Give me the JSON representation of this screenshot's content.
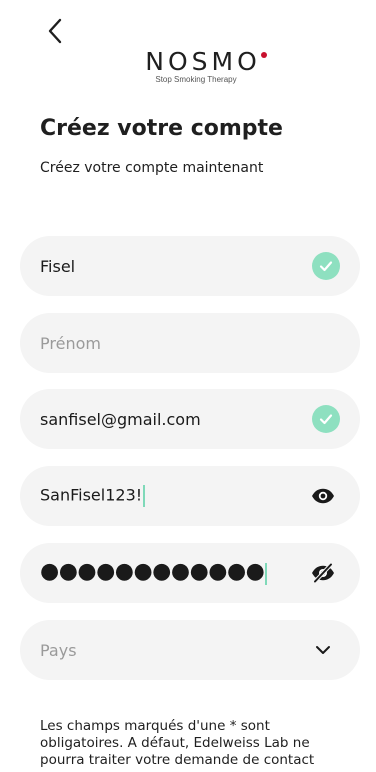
{
  "logo": {
    "wordmark": "NOSMO",
    "tagline": "Stop Smoking Therapy",
    "accent_color": "#c8102e"
  },
  "header": {
    "back_icon": "chevron-left-icon"
  },
  "title": "Créez votre compte",
  "subtitle": "Créez votre compte maintenant",
  "form": {
    "last_name": {
      "value": "Fisel",
      "valid": true
    },
    "first_name": {
      "placeholder": "Prénom",
      "value": ""
    },
    "email": {
      "value": "sanfisel@gmail.com",
      "valid": true
    },
    "password": {
      "value": "SanFisel123!",
      "visibility_icon": "eye-icon"
    },
    "password_confirm": {
      "masked": "●●●●●●●●●●●●",
      "visibility_icon": "eye-off-icon"
    },
    "country": {
      "placeholder": "Pays",
      "icon": "chevron-down-icon"
    }
  },
  "notice": "Les champs marqués d'une * sont obligatoires. A défaut, Edelweiss Lab ne pourra traiter votre demande de contact",
  "colors": {
    "field_bg": "#f4f4f4",
    "check_bg": "#8ee0c0",
    "caret": "#7fd9b9",
    "text": "#1a1a1a",
    "placeholder": "#9a9a9a"
  }
}
